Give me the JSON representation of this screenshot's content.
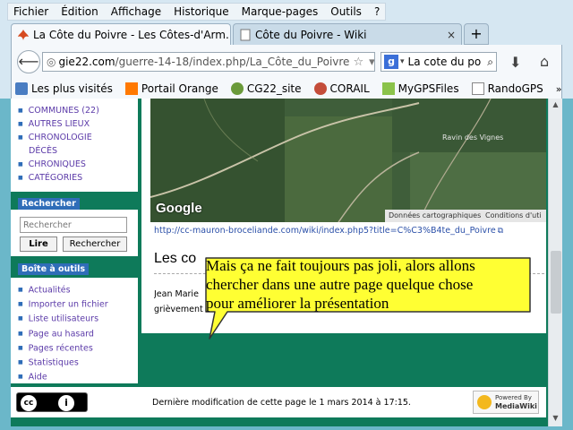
{
  "menubar": {
    "items": [
      "Fichier",
      "Édition",
      "Affichage",
      "Historique",
      "Marque-pages",
      "Outils",
      "?"
    ]
  },
  "tabs": [
    {
      "label": "La Côte du Poivre - Les Côtes-d'Arm...",
      "close": "×",
      "active": true
    },
    {
      "label": "Côte du Poivre - Wiki",
      "close": "×",
      "active": false
    }
  ],
  "newtab": "+",
  "navbar": {
    "url_host": "gie22.com",
    "url_path": "/guerre-14-18/index.php/La_Côte_du_Poivre",
    "search_text": "La cote du po",
    "search_engine_letter": "g"
  },
  "bookmarks": [
    "Les plus visités",
    "Portail Orange",
    "CG22_site",
    "CORAIL",
    "MyGPSFiles",
    "RandoGPS"
  ],
  "bookmarks_more": "»",
  "sidebar": {
    "nav_items": [
      {
        "label": "COMMUNES (22)"
      },
      {
        "label": "AUTRES LIEUX"
      },
      {
        "label": "CHRONOLOGIE"
      },
      {
        "label": "DÉCÈS",
        "continuation": true
      },
      {
        "label": "CHRONIQUES"
      },
      {
        "label": "CATÉGORIES"
      }
    ],
    "search_title": "Rechercher",
    "search_placeholder": "Rechercher",
    "read_button": "Lire",
    "search_button": "Rechercher",
    "tools_title": "Boîte à outils",
    "tools": [
      "Actualités",
      "Importer un fichier",
      "Liste utilisateurs",
      "Page au hasard",
      "Pages récentes",
      "Statistiques",
      "Aide"
    ]
  },
  "main": {
    "map_place": "Ravin des Vignes",
    "map_logo": "Google",
    "map_data_label": "Données cartographiques",
    "map_terms_label": "Conditions d'uti",
    "map_link": "http://cc-mauron-broceliande.com/wiki/index.php5?title=C%C3%B4te_du_Poivre",
    "section_title": "Les co",
    "body_lines": [
      "Jean Marie",
      "grièvement"
    ]
  },
  "callout": {
    "lines": [
      "Mais ça ne fait toujours pas joli, alors allons",
      "chercher dans une autre page quelque chose",
      "pour améliorer la présentation"
    ]
  },
  "footer": {
    "last_modified": "Dernière modification de cette page le 1 mars 2014 à 17:15.",
    "cc_text": "cc",
    "cc_by": "i",
    "mediawiki_powered": "Powered By",
    "mediawiki_name": "MediaWiki"
  }
}
